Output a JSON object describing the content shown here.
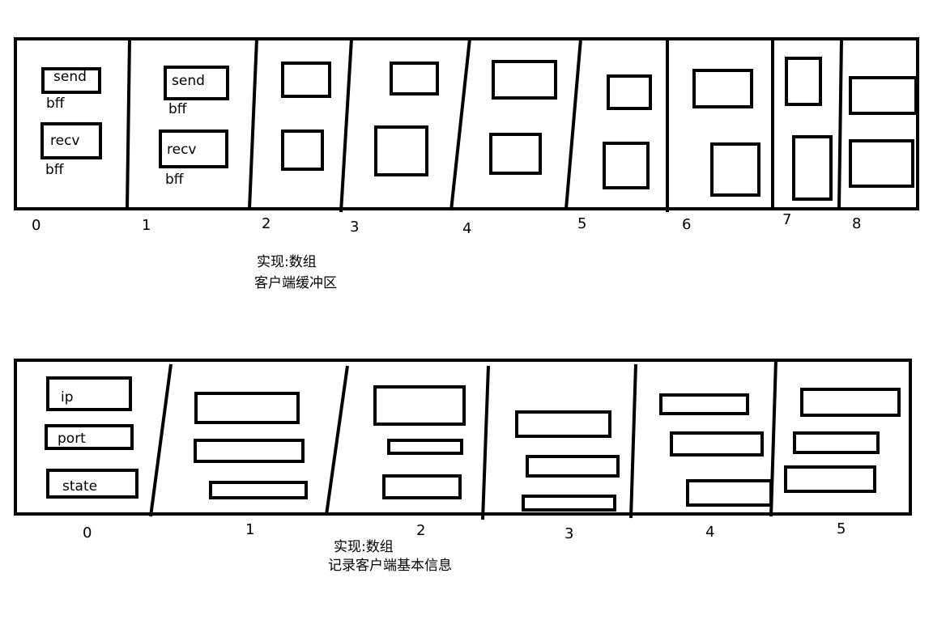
{
  "diagram1": {
    "indices": [
      "0",
      "1",
      "2",
      "3",
      "4",
      "5",
      "6",
      "7",
      "8"
    ],
    "cell0": {
      "send": "send",
      "send_sub": "bff",
      "recv": "recv",
      "recv_sub": "bff"
    },
    "cell1": {
      "send": "send",
      "send_sub": "bff",
      "recv": "recv",
      "recv_sub": "bff"
    },
    "caption_line1": "实现:数组",
    "caption_line2": "客户端缓冲区"
  },
  "diagram2": {
    "indices": [
      "0",
      "1",
      "2",
      "3",
      "4",
      "5"
    ],
    "cell0": {
      "ip": "ip",
      "port": "port",
      "state": "state"
    },
    "caption_line1": "实现:数组",
    "caption_line2": "记录客户端基本信息"
  }
}
